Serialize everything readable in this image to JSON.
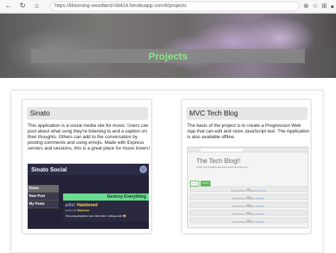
{
  "browser": {
    "url": "https://blooming-woodland-08424.herokuapp.com/#/projects",
    "icons": {
      "back": "back-arrow-icon",
      "refresh": "refresh-icon",
      "home": "home-icon",
      "lock": "lock-icon"
    }
  },
  "hero": {
    "title": "Projects"
  },
  "projects": [
    {
      "title": "Sinato",
      "description": "This application is a social media site for music. Users can post about what song they're listening to and a caption on their thoughts. Others can add to the conversation by posting comments and using emojis. Made with Express servers and sessions, this is a great place for music lovers!",
      "preview": {
        "brand": "Sinato Social",
        "nav": [
          "Home",
          "New Post",
          "My Posts"
        ],
        "song": "Destroy Everything",
        "artist_label": "artist:",
        "artist": "Hatebreed",
        "posted_by_label": "posted by",
        "posted_by": "Stephanie",
        "caption": "This song describes how I feel when I debug code! 😂"
      }
    },
    {
      "title": "MVC Tech Blog",
      "description": "The basis of the project is to create a Progression Web App that can edit and store JavaScript text. The Application is also available offline.",
      "preview": {
        "title": "The Tech Blog!!",
        "tagline": "Share your thoughts and ideas about all things tech!",
        "buttons": [
          "Login",
          "Signup"
        ],
        "posts": [
          {
            "title": "stuff",
            "meta": "By: stephanitame on 4/13/2022 | ",
            "link": "Comments"
          },
          {
            "title": "stuff",
            "meta": "By: stephanie on 4/13/2022 | ",
            "link": "Comments"
          },
          {
            "title": "stuff",
            "meta": "By: stephanie on 4/13/2022 | ",
            "link": "Comments"
          },
          {
            "title": "stuff",
            "meta": "By: stephanie on 4/13/2022 | ",
            "link": "Comments"
          },
          {
            "title": "stuff",
            "meta": "By: stephanie on 4/13/2022 | ",
            "link": "Comments"
          }
        ]
      }
    }
  ]
}
